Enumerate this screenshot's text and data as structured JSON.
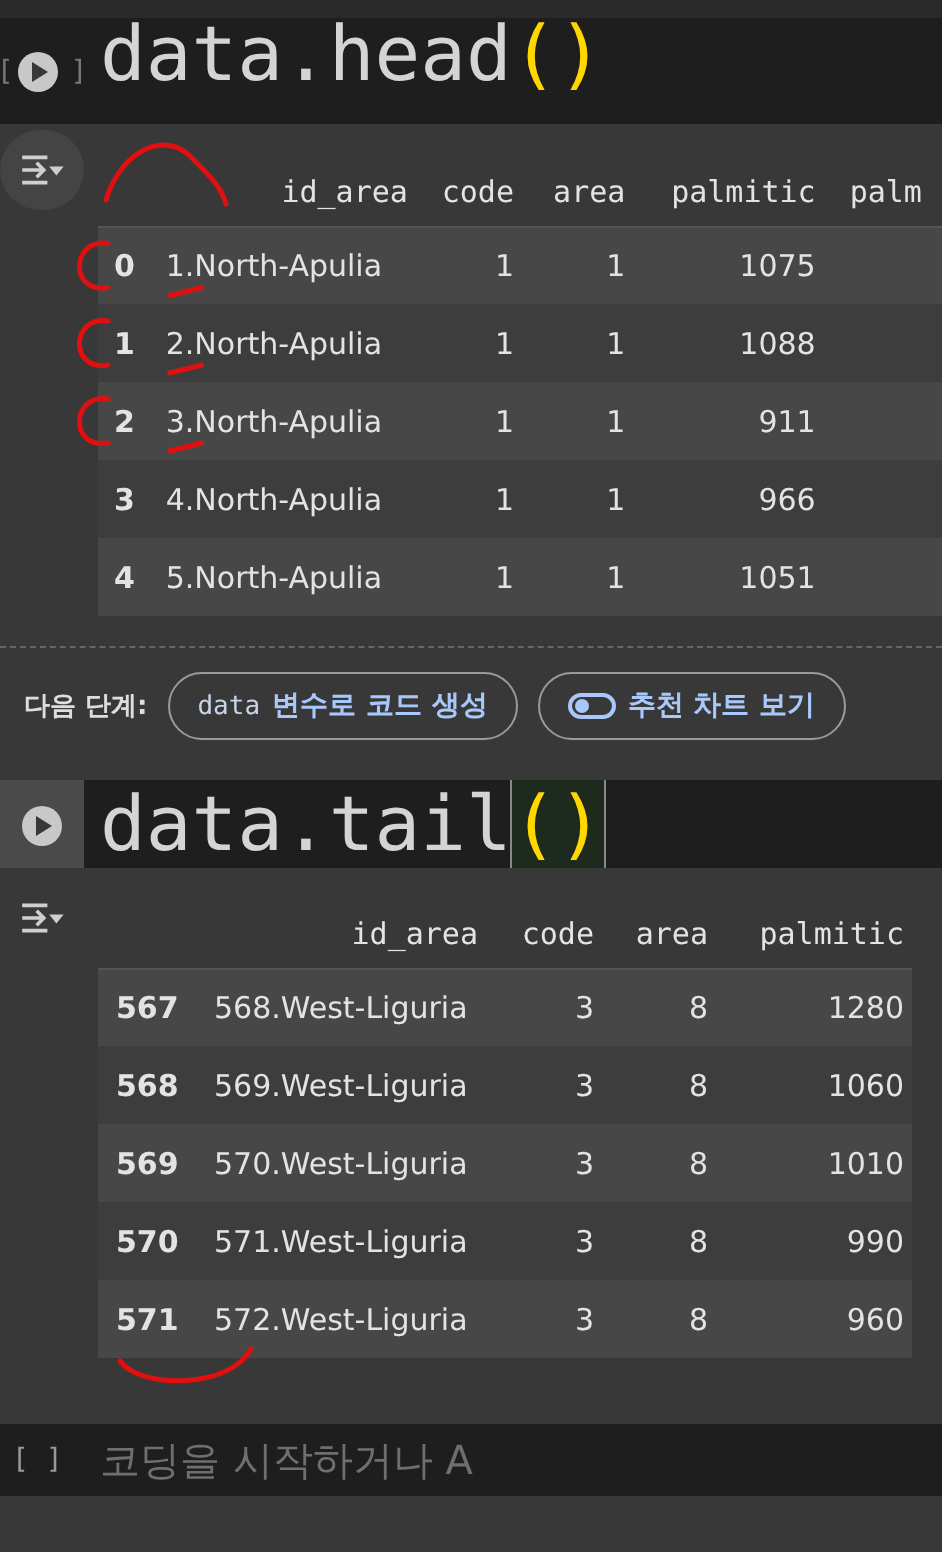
{
  "cells": [
    {
      "kind": "code",
      "run_label": "[ ]",
      "tokens": [
        {
          "text": "data.head",
          "kind": "plain"
        },
        {
          "text": "()",
          "kind": "bracket"
        }
      ],
      "bracket_matched": false,
      "output": {
        "columns": [
          "",
          "id_area",
          "code",
          "area",
          "palmitic",
          "palm"
        ],
        "rows": [
          [
            "0",
            "1.North-Apulia",
            "1",
            "1",
            "1075"
          ],
          [
            "1",
            "2.North-Apulia",
            "1",
            "1",
            "1088"
          ],
          [
            "2",
            "3.North-Apulia",
            "1",
            "1",
            "911"
          ],
          [
            "3",
            "4.North-Apulia",
            "1",
            "1",
            "966"
          ],
          [
            "4",
            "5.North-Apulia",
            "1",
            "1",
            "1051"
          ]
        ],
        "next_steps": {
          "label": "다음 단계:",
          "actions": [
            {
              "kind": "code",
              "code": "data",
              "text": "변수로 코드 생성"
            },
            {
              "kind": "chart",
              "text": "추천 차트 보기"
            }
          ]
        }
      }
    },
    {
      "kind": "code",
      "tokens": [
        {
          "text": "data.tail",
          "kind": "plain"
        },
        {
          "text": "()",
          "kind": "bracket"
        }
      ],
      "bracket_matched": true,
      "output": {
        "columns": [
          "",
          "id_area",
          "code",
          "area",
          "palmitic"
        ],
        "rows": [
          [
            "567",
            "568.West-Liguria",
            "3",
            "8",
            "1280"
          ],
          [
            "568",
            "569.West-Liguria",
            "3",
            "8",
            "1060"
          ],
          [
            "569",
            "570.West-Liguria",
            "3",
            "8",
            "1010"
          ],
          [
            "570",
            "571.West-Liguria",
            "3",
            "8",
            "990"
          ],
          [
            "571",
            "572.West-Liguria",
            "3",
            "8",
            "960"
          ]
        ]
      }
    },
    {
      "kind": "empty",
      "run_label": "[ ]",
      "placeholder": "코딩을 시작하거나 A"
    }
  ]
}
